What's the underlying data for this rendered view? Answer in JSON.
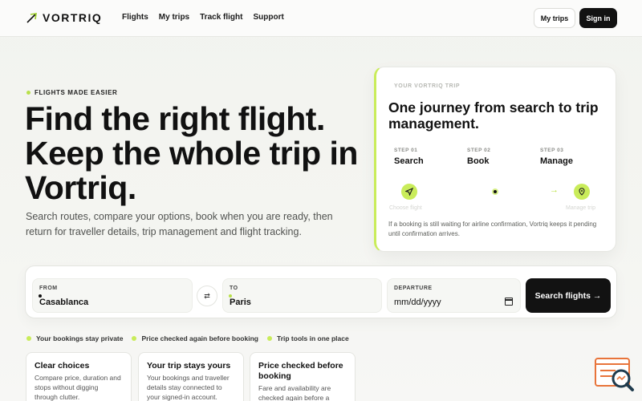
{
  "brand": {
    "name": "VORTRIQ"
  },
  "nav": [
    {
      "label": "Flights"
    },
    {
      "label": "My trips"
    },
    {
      "label": "Track flight"
    },
    {
      "label": "Support"
    }
  ],
  "header_actions": {
    "my_trips": "My trips",
    "sign_in": "Sign in"
  },
  "hero": {
    "eyebrow": "FLIGHTS MADE EASIER",
    "title": "Find the right flight. Keep the whole trip in Vortriq.",
    "subtitle": "Search routes, compare your options, book when you are ready, then return for traveller details, trip management and flight tracking."
  },
  "journey": {
    "eyebrow": "YOUR VORTRIQ TRIP",
    "title": "One journey from search to trip management.",
    "steps": [
      {
        "label": "STEP 01",
        "name": "Search"
      },
      {
        "label": "STEP 02",
        "name": "Book"
      },
      {
        "label": "STEP 03",
        "name": "Manage"
      }
    ],
    "faded_left": "Choose flight",
    "faded_right": "Manage trip",
    "note": "If a booking is still waiting for airline confirmation, Vortriq keeps it pending until confirmation arrives."
  },
  "search": {
    "from_label": "FROM",
    "from_value": "Casablanca",
    "to_label": "TO",
    "to_value": "Paris",
    "departure_label": "DEPARTURE",
    "departure_value": "mm/dd/yyyy",
    "button": "Search flights →"
  },
  "trust": [
    {
      "label": "Your bookings stay private"
    },
    {
      "label": "Price checked again before booking"
    },
    {
      "label": "Trip tools in one place"
    }
  ],
  "features": [
    {
      "title": "Clear choices",
      "text": "Compare price, duration and stops without digging through clutter."
    },
    {
      "title": "Your trip stays yours",
      "text": "Your bookings and traveller details stay connected to your signed-in account."
    },
    {
      "title": "Price checked before booking",
      "text": "Fare and availability are checked again before a"
    }
  ],
  "colors": {
    "accent": "#c9ec5a",
    "dark": "#121212",
    "widget": "#e8743a"
  }
}
